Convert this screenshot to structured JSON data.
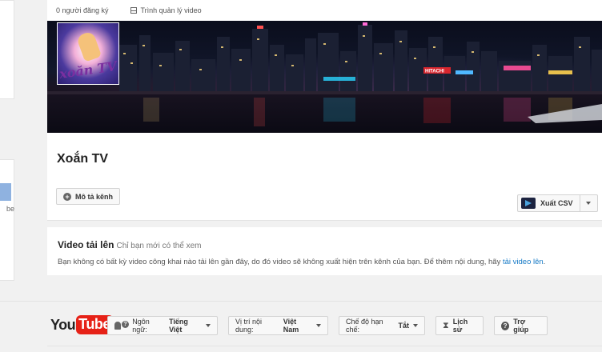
{
  "stats": {
    "subscribers": "0 người đăng ký",
    "video_manager": "Trình quản lý video"
  },
  "avatar": {
    "logo_text": "xoăn TV"
  },
  "banner": {
    "sign_text": "HITACHI"
  },
  "channel": {
    "name": "Xoắn TV",
    "describe_button": "Mô tả kênh",
    "export_button": "Xuất CSV"
  },
  "uploads": {
    "title": "Video tải lên",
    "subtitle": "Chỉ bạn mới có thể xem",
    "message": "Bạn không có bất kỳ video công khai nào tải lên gần đây, do đó video sẽ không xuất hiện trên kênh của bạn. Để thêm nội dung, hãy ",
    "link": "tải video lên",
    "message_end": "."
  },
  "sidebar": {
    "snippet": "be"
  },
  "footer": {
    "logo_you": "You",
    "logo_tube": "Tube",
    "language_label": "Ngôn ngữ:",
    "language_value": "Tiếng Việt",
    "location_label": "Vị trí nội dung:",
    "location_value": "Việt Nam",
    "restricted_label": "Chế độ hạn chế:",
    "restricted_value": "Tắt",
    "history": "Lịch sử",
    "help": "Trợ giúp"
  },
  "colors": {
    "link": "#167ac6",
    "youtube_red": "#e62117"
  },
  "icons": {
    "plus": "plus-circle-icon",
    "csv": "csv-export-icon",
    "film": "film-icon",
    "language": "language-icon",
    "history": "hourglass-icon",
    "help": "help-icon"
  }
}
